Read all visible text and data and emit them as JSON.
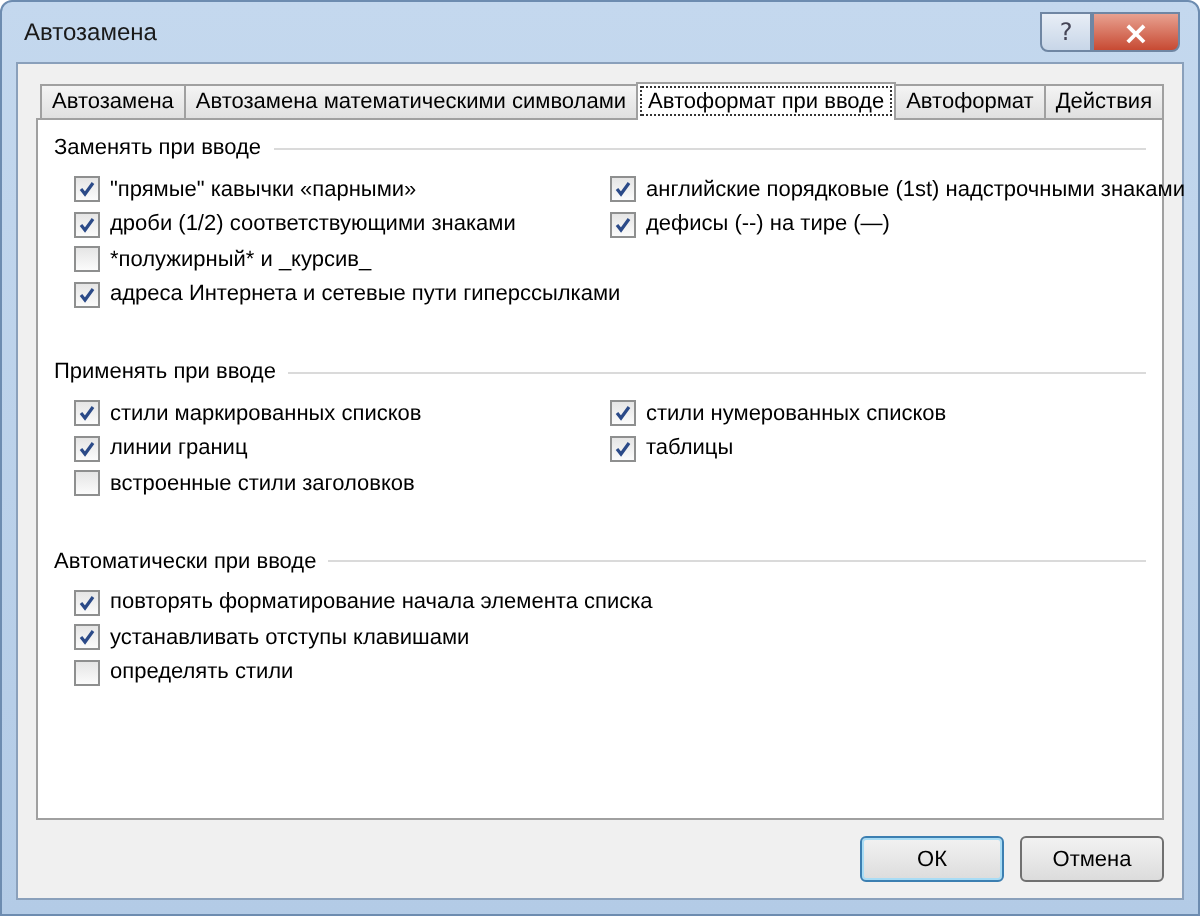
{
  "window": {
    "title": "Автозамена",
    "help_button": "?",
    "close_button": "×"
  },
  "tabs": [
    {
      "label": "Автозамена",
      "selected": false
    },
    {
      "label": "Автозамена математическими символами",
      "selected": false
    },
    {
      "label": "Автоформат при вводе",
      "selected": true
    },
    {
      "label": "Автоформат",
      "selected": false
    },
    {
      "label": "Действия",
      "selected": false
    }
  ],
  "sections": [
    {
      "title": "Заменять при вводе",
      "columns": [
        [
          {
            "label": "\"прямые\" кавычки «парными»",
            "checked": true
          },
          {
            "label": "дроби (1/2) соответствующими знаками",
            "checked": true
          },
          {
            "label": "*полужирный* и _курсив_",
            "checked": false
          },
          {
            "label": "адреса Интернета и сетевые пути гиперссылками",
            "checked": true
          }
        ],
        [
          {
            "label": "английские порядковые (1st) надстрочными знаками",
            "checked": true
          },
          {
            "label": "дефисы (--) на тире (—)",
            "checked": true
          }
        ]
      ]
    },
    {
      "title": "Применять при вводе",
      "columns": [
        [
          {
            "label": "стили маркированных списков",
            "checked": true
          },
          {
            "label": "линии границ",
            "checked": true
          },
          {
            "label": "встроенные стили заголовков",
            "checked": false
          }
        ],
        [
          {
            "label": "стили нумерованных списков",
            "checked": true
          },
          {
            "label": "таблицы",
            "checked": true
          }
        ]
      ]
    },
    {
      "title": "Автоматически при вводе",
      "columns": [
        [
          {
            "label": "повторять форматирование начала элемента списка",
            "checked": true
          },
          {
            "label": "устанавливать отступы клавишами",
            "checked": true
          },
          {
            "label": "определять стили",
            "checked": false
          }
        ]
      ]
    }
  ],
  "buttons": [
    {
      "label": "ОК",
      "kind": "default"
    },
    {
      "label": "Отмена",
      "kind": "normal"
    }
  ]
}
